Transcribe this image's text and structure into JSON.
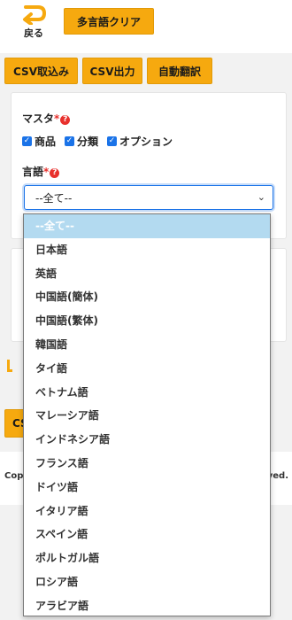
{
  "header": {
    "back_label": "戻る",
    "clear_button": "多言語クリア"
  },
  "toolbar": {
    "csv_import": "CSV取込み",
    "csv_export": "CSV出力",
    "auto_translate": "自動翻訳"
  },
  "form": {
    "master_label": "マスタ",
    "required_mark": "*",
    "help_glyph": "?",
    "checkboxes": [
      {
        "label": "商品",
        "checked": true
      },
      {
        "label": "分類",
        "checked": true
      },
      {
        "label": "オプション",
        "checked": true
      }
    ],
    "language_label": "言語",
    "language_selected": "--全て--"
  },
  "partial_button": "CS",
  "footer": {
    "left": "Cop",
    "right": "ved."
  },
  "language_options": [
    "--全て--",
    "日本語",
    "英語",
    "中国語(簡体)",
    "中国語(繁体)",
    "韓国語",
    "タイ語",
    "ベトナム語",
    "マレーシア語",
    "インドネシア語",
    "フランス語",
    "ドイツ語",
    "イタリア語",
    "スペイン語",
    "ポルトガル語",
    "ロシア語",
    "アラビア語"
  ],
  "colors": {
    "accent": "#f6a90f",
    "checkbox": "#1a73e8",
    "required": "#e8302c",
    "selected_option": "#b3daf0"
  }
}
